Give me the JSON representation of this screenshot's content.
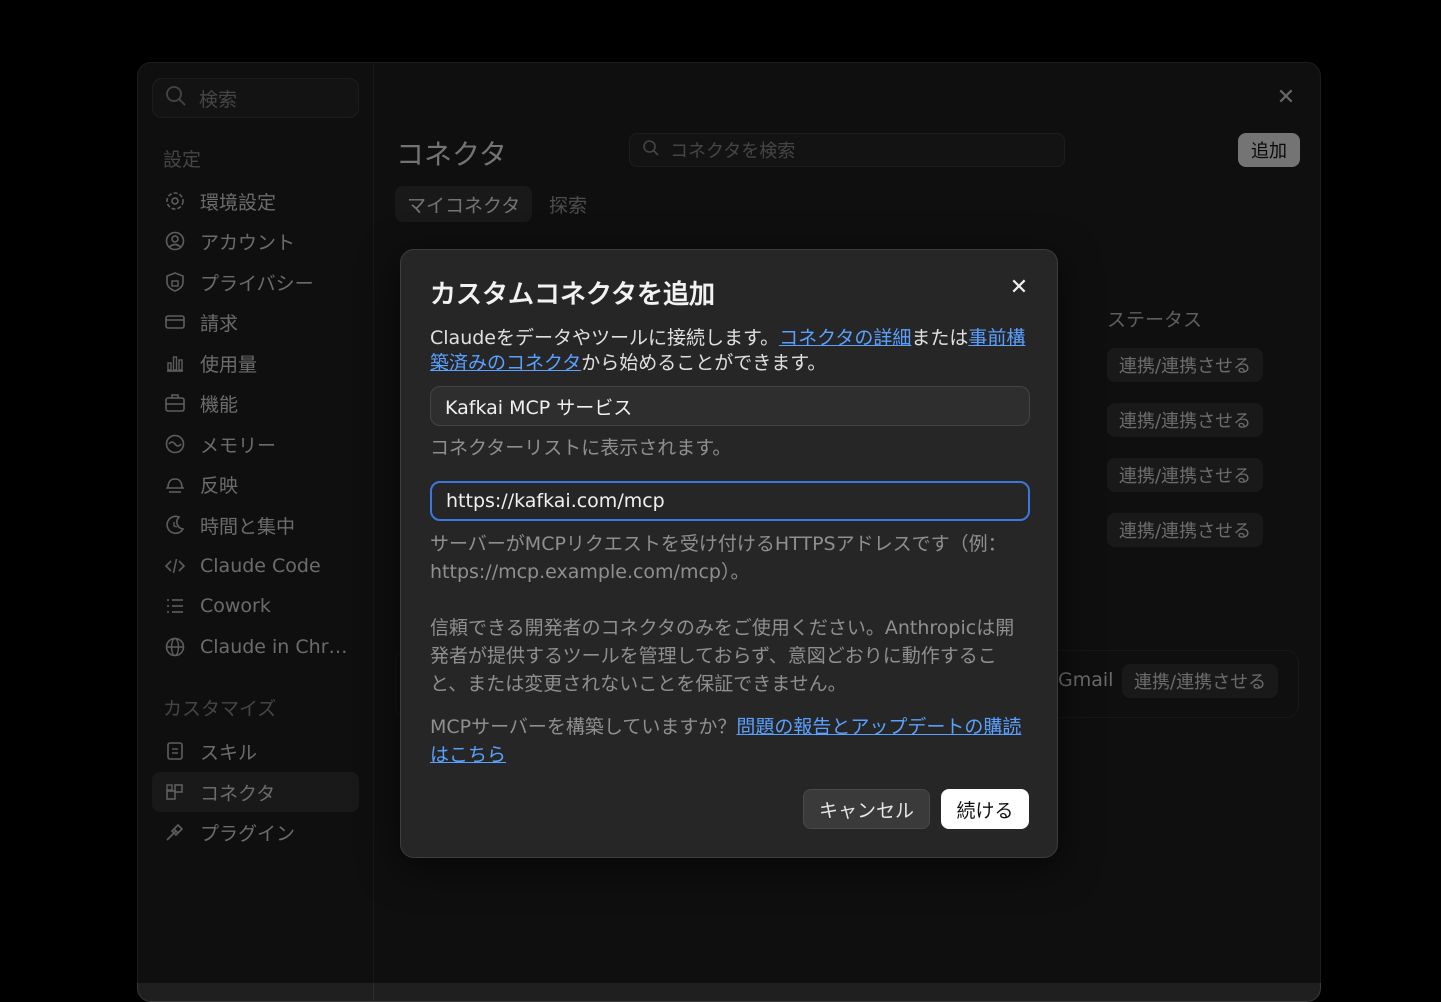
{
  "sidebar": {
    "search_placeholder": "検索",
    "settings_title": "設定",
    "settings_items": [
      {
        "label": "環境設定",
        "icon": "gear-icon"
      },
      {
        "label": "アカウント",
        "icon": "user-circle-icon"
      },
      {
        "label": "プライバシー",
        "icon": "shield-lock-icon"
      },
      {
        "label": "請求",
        "icon": "credit-card-icon"
      },
      {
        "label": "使用量",
        "icon": "bar-chart-icon"
      },
      {
        "label": "機能",
        "icon": "briefcase-icon"
      },
      {
        "label": "メモリー",
        "icon": "memory-icon"
      },
      {
        "label": "反映",
        "icon": "sunrise-icon"
      },
      {
        "label": "時間と集中",
        "icon": "moon-clock-icon"
      },
      {
        "label": "Claude Code",
        "icon": "code-icon"
      },
      {
        "label": "Cowork",
        "icon": "list-icon"
      },
      {
        "label": "Claude in Chr…",
        "icon": "globe-icon"
      }
    ],
    "customize_title": "カスタマイズ",
    "customize_items": [
      {
        "label": "スキル",
        "icon": "skill-icon"
      },
      {
        "label": "コネクタ",
        "icon": "connector-icon",
        "active": true
      },
      {
        "label": "プラグイン",
        "icon": "plugin-icon"
      }
    ]
  },
  "main": {
    "title": "コネクタ",
    "search_placeholder": "コネクタを検索",
    "add_label": "追加",
    "tabs": [
      {
        "label": "マイコネクタ",
        "active": true
      },
      {
        "label": "探索",
        "active": false
      }
    ],
    "status_header": "ステータス",
    "status_labels": [
      "連携/連携させる",
      "連携/連携させる",
      "連携/連携させる",
      "連携/連携させる"
    ],
    "gmail_label": "Gmail",
    "gmail_status": "連携/連携させる"
  },
  "dialog": {
    "title": "カスタムコネクタを追加",
    "desc_prefix": "Claudeをデータやツールに接続します。",
    "desc_link1": "コネクタの詳細",
    "desc_mid": "または",
    "desc_link2": "事前構築済みのコネクタ",
    "desc_suffix": "から始めることができます。",
    "name_value": "Kafkai MCP サービス",
    "name_hint": "コネクターリストに表示されます。",
    "url_value": "https://kafkai.com/mcp",
    "url_hint": "サーバーがMCPリクエストを受け付けるHTTPSアドレスです（例：https://mcp.example.com/mcp）。",
    "warning": "信頼できる開発者のコネクタのみをご使用ください。Anthropicは開発者が提供するツールを管理しておらず、意図どおりに動作すること、または変更されないことを保証できません。",
    "mcp_prefix": "MCPサーバーを構築していますか？",
    "mcp_link": "問題の報告とアップデートの購読はこちら",
    "cancel_label": "キャンセル",
    "continue_label": "続ける"
  }
}
